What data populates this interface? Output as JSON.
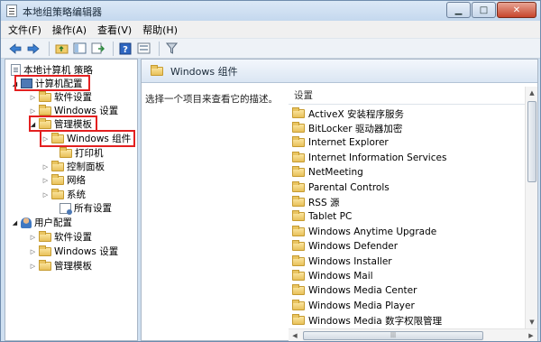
{
  "window": {
    "title": "本地组策略编辑器",
    "minimize": "▁",
    "maximize": "□",
    "close": "✕"
  },
  "menu": [
    "文件(F)",
    "操作(A)",
    "查看(V)",
    "帮助(H)"
  ],
  "toolbar_icons": [
    "back-arrow-icon",
    "forward-arrow-icon",
    "up-folder-icon",
    "show-tree-icon",
    "export-icon",
    "help-icon",
    "properties-icon",
    "filter-icon"
  ],
  "tree": {
    "root": "本地计算机 策略",
    "computer_config": "计算机配置",
    "software_settings": "软件设置",
    "windows_settings": "Windows 设置",
    "admin_templates": "管理模板",
    "windows_components": "Windows 组件",
    "printers": "打印机",
    "control_panel": "控制面板",
    "network": "网络",
    "system": "系统",
    "all_settings": "所有设置",
    "user_config": "用户配置",
    "user_software_settings": "软件设置",
    "user_windows_settings": "Windows 设置",
    "user_admin_templates": "管理模板"
  },
  "right": {
    "header": "Windows 组件",
    "description": "选择一个项目来查看它的描述。",
    "column_header": "设置",
    "items": [
      "ActiveX 安装程序服务",
      "BitLocker 驱动器加密",
      "Internet Explorer",
      "Internet Information Services",
      "NetMeeting",
      "Parental Controls",
      "RSS 源",
      "Tablet PC",
      "Windows Anytime Upgrade",
      "Windows Defender",
      "Windows Installer",
      "Windows Mail",
      "Windows Media Center",
      "Windows Media Player",
      "Windows Media 数字权限管理"
    ]
  },
  "colors": {
    "highlight_box": "#e32020",
    "title_bar": "#c4d8ee"
  }
}
